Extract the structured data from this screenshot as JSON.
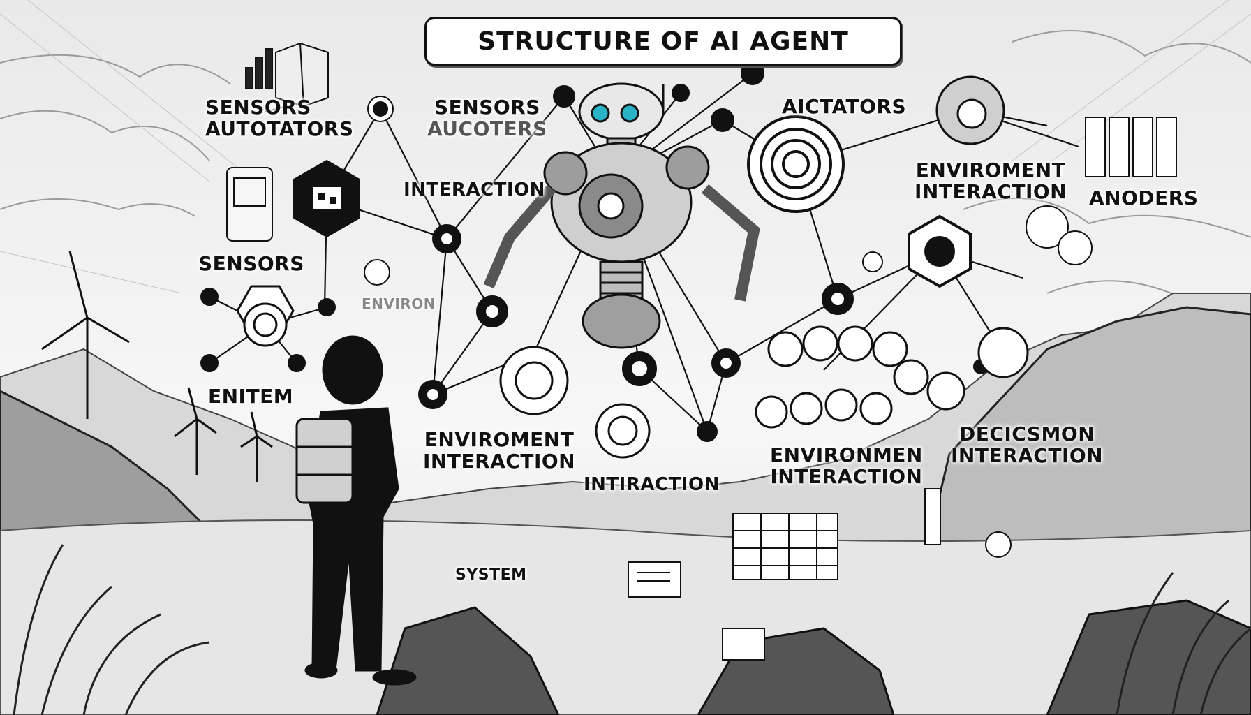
{
  "title": "STRUCTURE OF AI AGENT",
  "labels": {
    "sensors_autotators": [
      "SENSORS",
      "AUTOTATORS"
    ],
    "sensors_aucoters": [
      "SENSORS",
      "AUCOTERS"
    ],
    "interaction_top": "INTERACTION",
    "aictators": "AICTATORS",
    "enviroment_interaction_top": [
      "ENVIROMENT",
      "INTERACTION"
    ],
    "anoders": "ANODERS",
    "sensors_left": "SENSORS",
    "environ_faded": "ENVIRON",
    "enitem": "ENITEM",
    "enviroment_interaction_mid": [
      "ENVIROMENT",
      "INTERACTION"
    ],
    "intiraction": "INTIRACTION",
    "environmen_interaction": [
      "ENVIRONMEN",
      "INTERACTION"
    ],
    "decicsmon_interaction": [
      "DECICSMON",
      "INTERACTION"
    ],
    "system": "SYSTEM"
  },
  "colors": {
    "ink": "#111111",
    "paper": "#f2f2f2",
    "robot_eye": "#2ab3c7"
  }
}
